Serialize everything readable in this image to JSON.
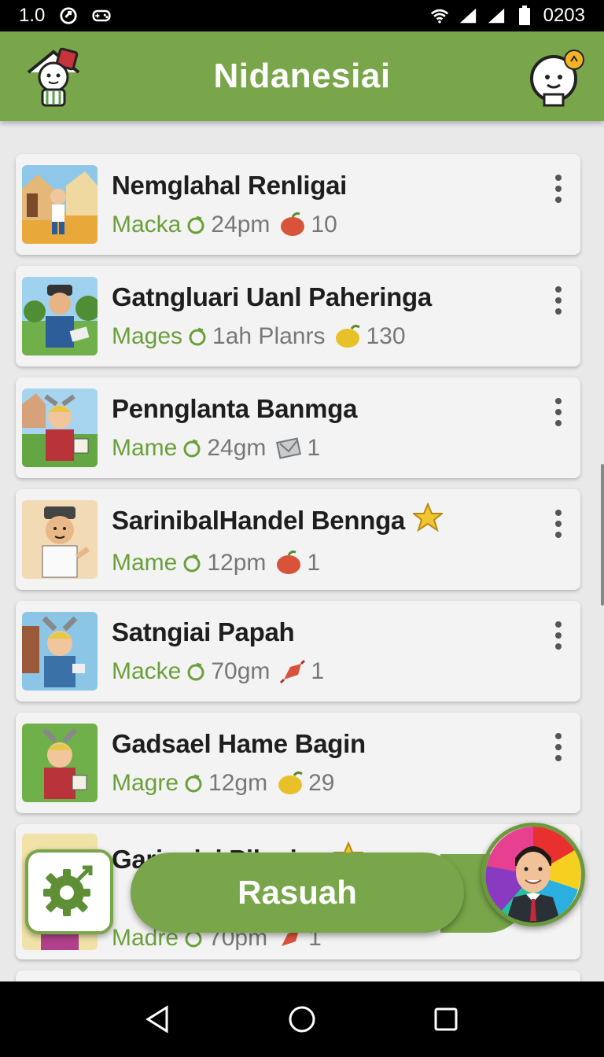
{
  "status_bar": {
    "left_text": "1.0",
    "time": "0203",
    "icons": [
      "sync-icon",
      "gamepad-icon",
      "wifi-icon",
      "signal-icon",
      "signal-icon",
      "battery-icon"
    ]
  },
  "app_bar": {
    "title": "Nidanesiai",
    "left_icon": "home-mascot-icon",
    "right_icon": "bot-mascot-icon",
    "color": "#79a64a"
  },
  "items": [
    {
      "title": "Nemglahal Renligai",
      "author": "Macka",
      "time": "24pm",
      "item_icon": "apple-icon",
      "count": "10",
      "badge": false
    },
    {
      "title": "Gatngluari Uanl Paheringa",
      "author": "Mages",
      "time": "1ah Planrs",
      "item_icon": "lemon-icon",
      "count": "130",
      "badge": false
    },
    {
      "title": "Pennglanta Banmga",
      "author": "Mame",
      "time": "24gm",
      "item_icon": "envelope-icon",
      "count": "1",
      "badge": false
    },
    {
      "title": "SarinibalHandel Bennga",
      "author": "Mame",
      "time": "12pm",
      "item_icon": "apple-icon",
      "count": "1",
      "badge": true
    },
    {
      "title": "Satngiai Papah",
      "author": "Macke",
      "time": "70gm",
      "item_icon": "candy-icon",
      "count": "1",
      "badge": false
    },
    {
      "title": "Gadsael Hame Bagin",
      "author": "Magre",
      "time": "12gm",
      "item_icon": "lemon-icon",
      "count": "29",
      "badge": false
    },
    {
      "title": "Gariogiai Pilanisa",
      "author": "Madre",
      "time": "70pm",
      "item_icon": "candy-icon",
      "count": "1",
      "badge": true
    }
  ],
  "floating_bar": {
    "label": "Rasuah",
    "settings_icon": "gear-icon",
    "profile_icon": "avatar"
  },
  "nav_bar": {
    "icons": [
      "back-icon",
      "home-icon",
      "recents-icon"
    ]
  },
  "colors": {
    "accent": "#79a64a",
    "author_text": "#6aa03a",
    "background": "#e9e9e9"
  }
}
